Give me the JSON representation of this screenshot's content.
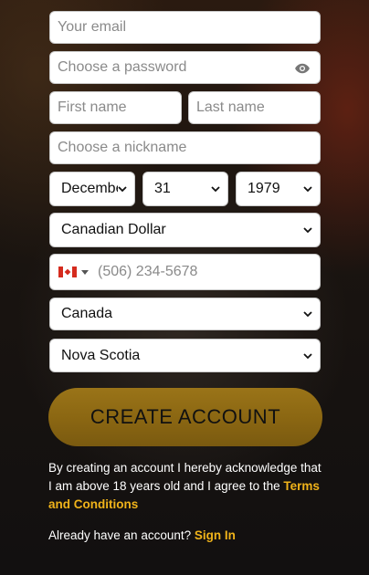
{
  "form": {
    "email_placeholder": "Your email",
    "password_placeholder": "Choose a password",
    "first_name_placeholder": "First name",
    "last_name_placeholder": "Last name",
    "nickname_placeholder": "Choose a nickname",
    "birth_month": "Decembe",
    "birth_day": "31",
    "birth_year": "1979",
    "currency": "Canadian Dollar",
    "phone_placeholder": "(506) 234-5678",
    "country": "Canada",
    "province": "Nova Scotia",
    "create_button": "CREATE ACCOUNT",
    "terms_text": "By creating an account I hereby acknowledge that I am above 18 years old and I agree to the ",
    "terms_link": "Terms and Conditions",
    "signin_text": "Already have an account? ",
    "signin_link": "Sign In"
  },
  "colors": {
    "accent": "#f0b31a",
    "button": "#8a6612",
    "flag_red": "#d52b1e"
  },
  "icons": [
    "eye-icon",
    "canada-flag-icon",
    "caret-down-icon",
    "chevron-down-icon"
  ]
}
